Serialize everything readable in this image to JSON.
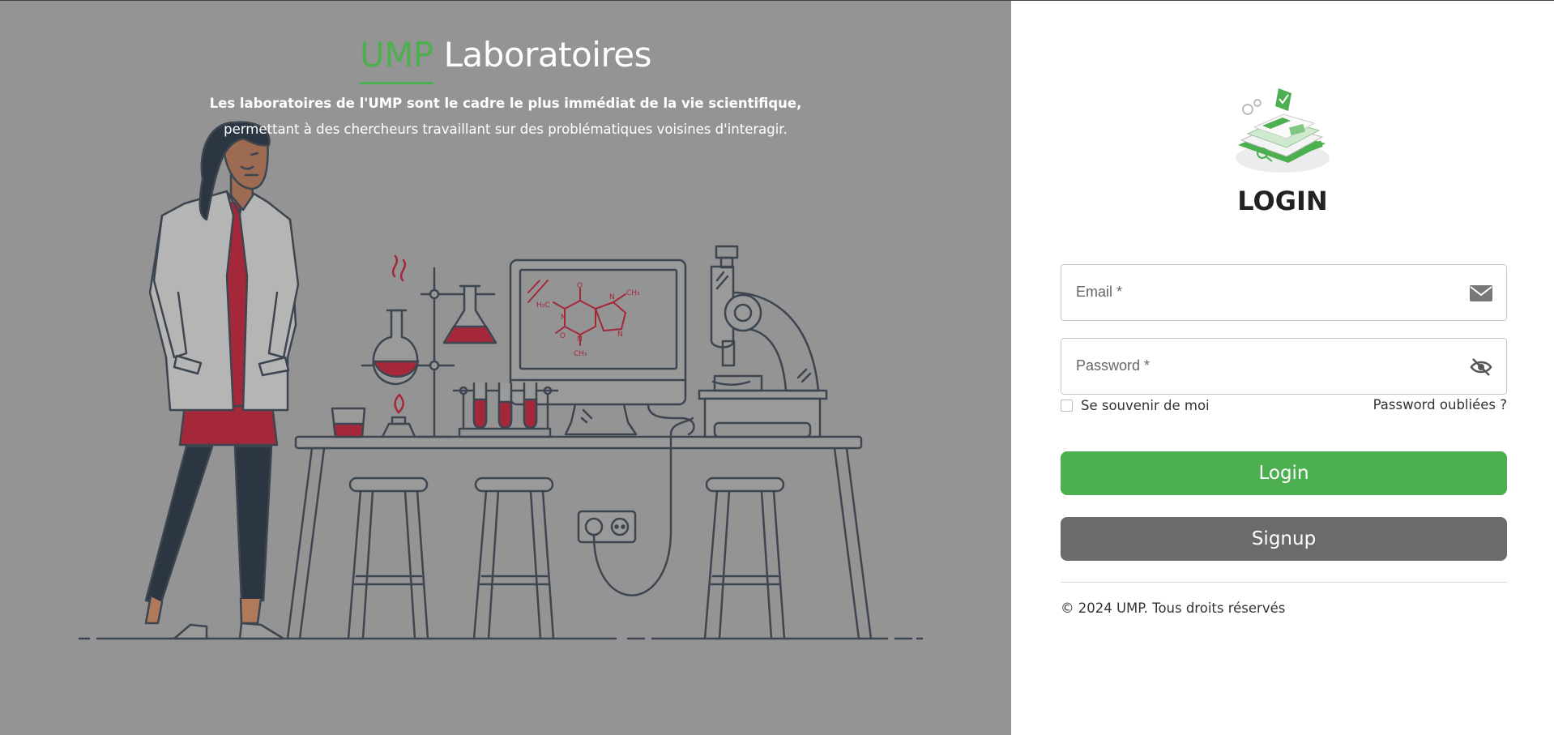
{
  "left": {
    "brand_accent": "UMP",
    "brand_rest": "Laboratoires",
    "tagline_line1": "Les laboratoires de l'UMP sont le cadre le plus immédiat de la vie scientifique,",
    "tagline_line2": "permettant à des chercheurs travaillant sur des problématiques voisines d'interagir.",
    "molecule_labels": {
      "ch3_top": "CH₃",
      "ch3_left": "H₃C",
      "ch3_bottom": "CH₃",
      "o_top": "O",
      "o_left": "O",
      "n1": "N",
      "n2": "N",
      "n3": "N",
      "n4": "N"
    }
  },
  "form": {
    "title": "LOGIN",
    "email_label": "Email *",
    "password_label": "Password *",
    "remember_label": "Se souvenir de moi",
    "forgot_label": "Password oubliées ?",
    "login_button": "Login",
    "signup_button": "Signup",
    "copyright": "© 2024 UMP. Tous droits réservés"
  },
  "icons": {
    "email": "envelope-icon",
    "password": "eye-slash-icon",
    "logo": "lab-documents-illustration"
  },
  "colors": {
    "accent_green": "#4caf50",
    "signup_gray": "#6b6b6a",
    "left_background": "#949494",
    "illustration_red": "#a5283a",
    "line_dark": "#3d4650"
  }
}
